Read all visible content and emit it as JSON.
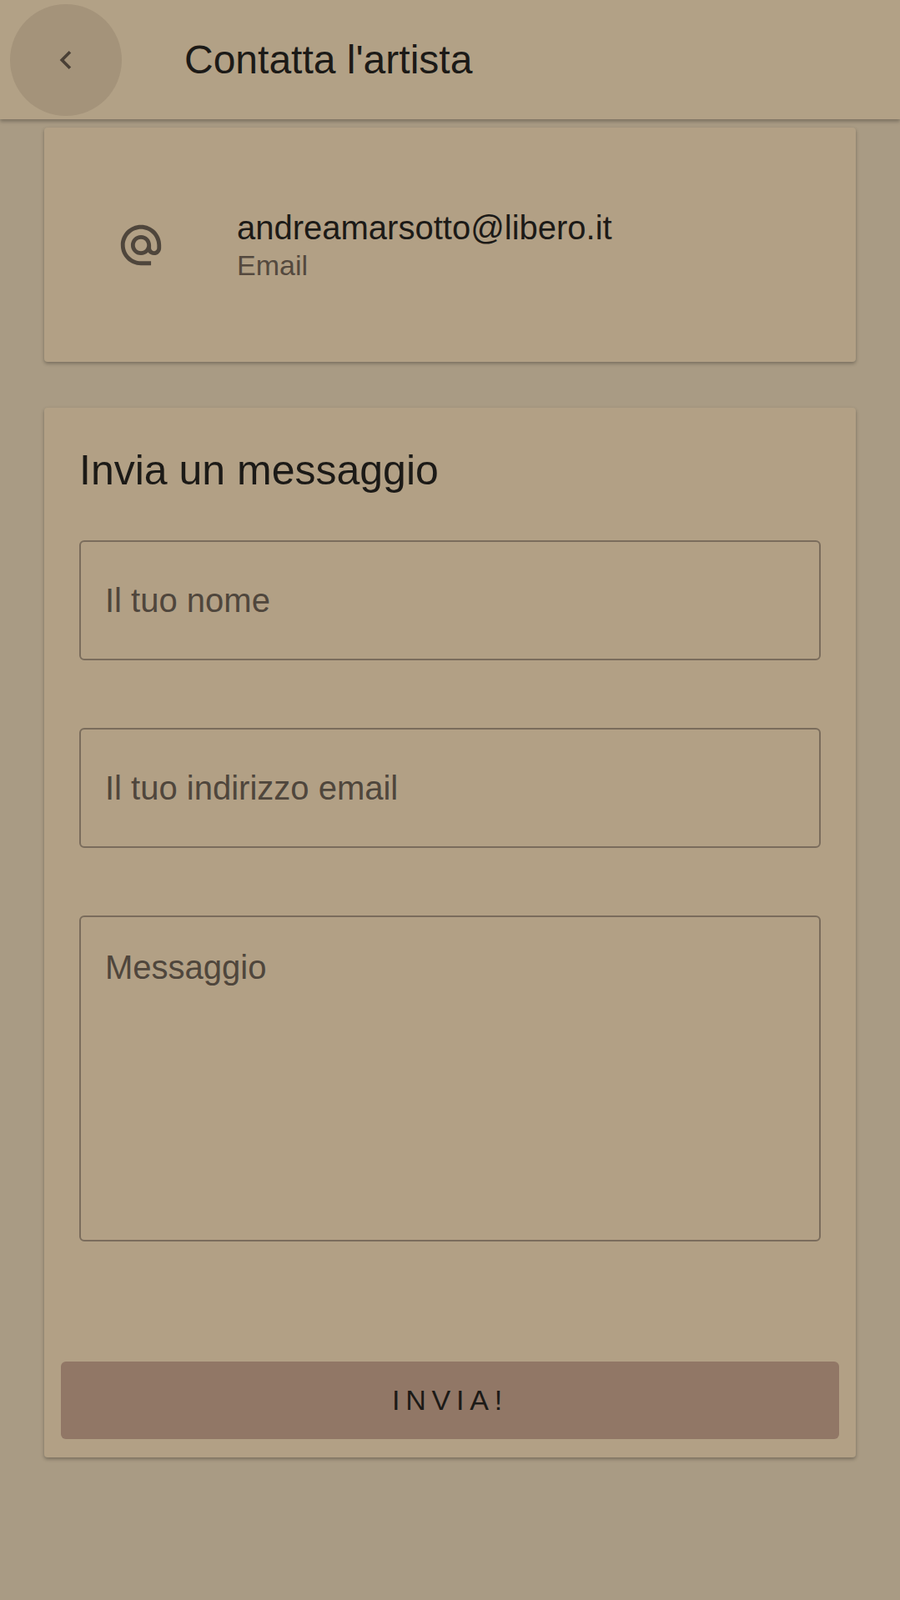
{
  "header": {
    "title": "Contatta l'artista"
  },
  "contact": {
    "value": "andreamarsotto@libero.it",
    "label": "Email"
  },
  "form": {
    "title": "Invia un messaggio",
    "fields": [
      {
        "placeholder": "Il tuo nome",
        "kind": "input"
      },
      {
        "placeholder": "Il tuo indirizzo email",
        "kind": "input"
      },
      {
        "placeholder": "Messaggio",
        "kind": "textarea"
      }
    ],
    "button": "INVIA!"
  }
}
